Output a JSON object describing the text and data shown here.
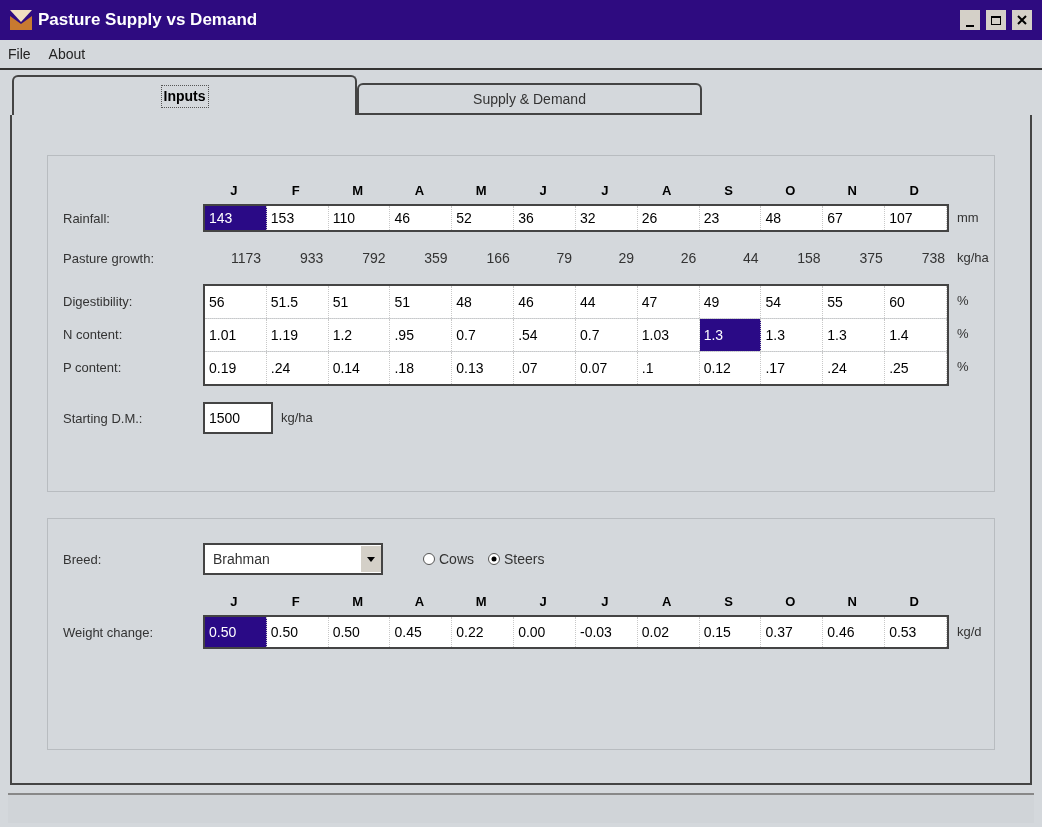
{
  "window": {
    "title": "Pasture Supply vs Demand"
  },
  "menu": [
    "File",
    "About"
  ],
  "tabs": [
    {
      "label": "Inputs",
      "selected": true
    },
    {
      "label": "Supply & Demand",
      "selected": false
    }
  ],
  "supply": {
    "months": [
      "J",
      "F",
      "M",
      "A",
      "M",
      "J",
      "J",
      "A",
      "S",
      "O",
      "N",
      "D"
    ],
    "rainfall": {
      "label": "Rainfall:",
      "unit": "mm",
      "cells": [
        {
          "value": "143",
          "selected": true
        },
        {
          "value": "153",
          "selected": false
        },
        {
          "value": "110",
          "selected": false
        },
        {
          "value": "46",
          "selected": false
        },
        {
          "value": "52",
          "selected": false
        },
        {
          "value": "36",
          "selected": false
        },
        {
          "value": "32",
          "selected": false
        },
        {
          "value": "26",
          "selected": false
        },
        {
          "value": "23",
          "selected": false
        },
        {
          "value": "48",
          "selected": false
        },
        {
          "value": "67",
          "selected": false
        },
        {
          "value": "107",
          "selected": false
        }
      ]
    },
    "pasture_growth": {
      "label": "Pasture growth:",
      "unit": "kg/ha",
      "values": [
        "1173",
        "933",
        "792",
        "359",
        "166",
        "79",
        "29",
        "26",
        "44",
        "158",
        "375",
        "738"
      ]
    },
    "quality": [
      {
        "label": "Digestibility:",
        "unit": "%",
        "cells": [
          {
            "value": "56",
            "selected": false
          },
          {
            "value": "51.5",
            "selected": false
          },
          {
            "value": "51",
            "selected": false
          },
          {
            "value": "51",
            "selected": false
          },
          {
            "value": "48",
            "selected": false
          },
          {
            "value": "46",
            "selected": false
          },
          {
            "value": "44",
            "selected": false
          },
          {
            "value": "47",
            "selected": false
          },
          {
            "value": "49",
            "selected": false
          },
          {
            "value": "54",
            "selected": false
          },
          {
            "value": "55",
            "selected": false
          },
          {
            "value": "60",
            "selected": false
          }
        ]
      },
      {
        "label": "N content:",
        "unit": "%",
        "cells": [
          {
            "value": "1.01",
            "selected": false
          },
          {
            "value": "1.19",
            "selected": false
          },
          {
            "value": "1.2",
            "selected": false
          },
          {
            "value": ".95",
            "selected": false
          },
          {
            "value": "0.7",
            "selected": false
          },
          {
            "value": ".54",
            "selected": false
          },
          {
            "value": "0.7",
            "selected": false
          },
          {
            "value": "1.03",
            "selected": false
          },
          {
            "value": "1.3",
            "selected": true
          },
          {
            "value": "1.3",
            "selected": false
          },
          {
            "value": "1.3",
            "selected": false
          },
          {
            "value": "1.4",
            "selected": false
          }
        ]
      },
      {
        "label": "P content:",
        "unit": "%",
        "cells": [
          {
            "value": "0.19",
            "selected": false
          },
          {
            "value": ".24",
            "selected": false
          },
          {
            "value": "0.14",
            "selected": false
          },
          {
            "value": ".18",
            "selected": false
          },
          {
            "value": "0.13",
            "selected": false
          },
          {
            "value": ".07",
            "selected": false
          },
          {
            "value": "0.07",
            "selected": false
          },
          {
            "value": ".1",
            "selected": false
          },
          {
            "value": "0.12",
            "selected": false
          },
          {
            "value": ".17",
            "selected": false
          },
          {
            "value": ".24",
            "selected": false
          },
          {
            "value": ".25",
            "selected": false
          }
        ]
      }
    ],
    "starting_dm": {
      "label": "Starting D.M.:",
      "value": "1500",
      "unit": "kg/ha"
    }
  },
  "demand": {
    "breed": {
      "label": "Breed:",
      "value": "Brahman"
    },
    "sex": [
      {
        "label": "Cows",
        "selected": false
      },
      {
        "label": "Steers",
        "selected": true
      }
    ],
    "months": [
      "J",
      "F",
      "M",
      "A",
      "M",
      "J",
      "J",
      "A",
      "S",
      "O",
      "N",
      "D"
    ],
    "weight_change": {
      "label": "Weight change:",
      "unit": "kg/d",
      "cells": [
        {
          "value": "0.50",
          "selected": true
        },
        {
          "value": "0.50",
          "selected": false
        },
        {
          "value": "0.50",
          "selected": false
        },
        {
          "value": "0.45",
          "selected": false
        },
        {
          "value": "0.22",
          "selected": false
        },
        {
          "value": "0.00",
          "selected": false
        },
        {
          "value": "-0.03",
          "selected": false
        },
        {
          "value": "0.02",
          "selected": false
        },
        {
          "value": "0.15",
          "selected": false
        },
        {
          "value": "0.37",
          "selected": false
        },
        {
          "value": "0.46",
          "selected": false
        },
        {
          "value": "0.53",
          "selected": false
        }
      ]
    }
  }
}
